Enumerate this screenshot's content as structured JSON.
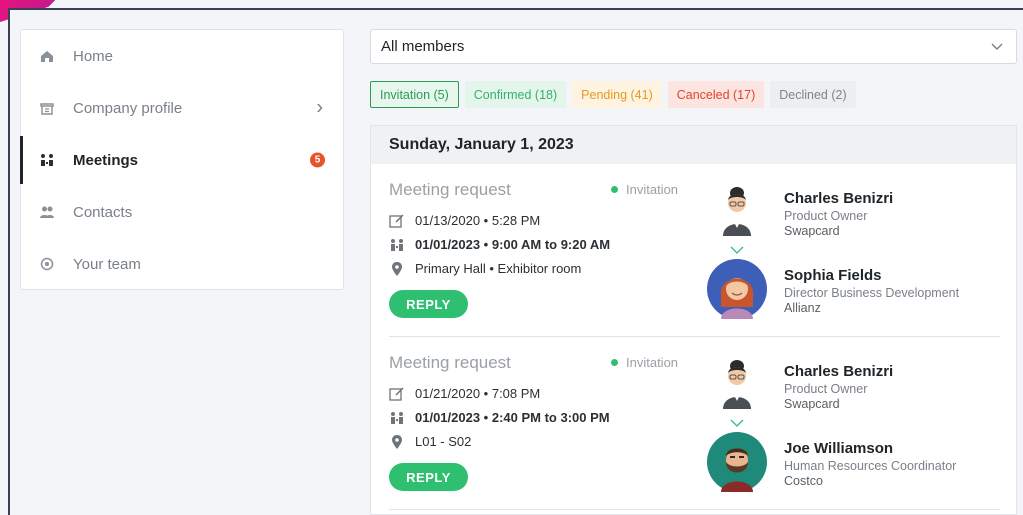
{
  "sidebar": {
    "items": [
      {
        "label": "Home",
        "icon": "home-icon"
      },
      {
        "label": "Company profile",
        "icon": "building-icon"
      },
      {
        "label": "Meetings",
        "icon": "meetings-icon",
        "badge": "5"
      },
      {
        "label": "Contacts",
        "icon": "contacts-icon"
      },
      {
        "label": "Your team",
        "icon": "team-icon"
      }
    ]
  },
  "filter": {
    "selected": "All members"
  },
  "tabs": [
    {
      "label": "Invitation (5)"
    },
    {
      "label": "Confirmed (18)"
    },
    {
      "label": "Pending (41)"
    },
    {
      "label": "Canceled (17)"
    },
    {
      "label": "Declined (2)"
    }
  ],
  "day_header": "Sunday, January 1, 2023",
  "meetings": [
    {
      "title": "Meeting request",
      "status": "Invitation",
      "requested": "01/13/2020 • 5:28 PM",
      "time": "01/01/2023 • 9:00 AM to 9:20 AM",
      "location": "Primary Hall • Exhibitor room",
      "reply_label": "REPLY",
      "host": {
        "name": "Charles Benizri",
        "role": "Product Owner",
        "company": "Swapcard"
      },
      "guest": {
        "name": "Sophia Fields",
        "role": "Director Business Development",
        "company": "Allianz"
      }
    },
    {
      "title": "Meeting request",
      "status": "Invitation",
      "requested": "01/21/2020 • 7:08 PM",
      "time": "01/01/2023 • 2:40 PM to 3:00 PM",
      "location": "L01 - S02",
      "reply_label": "REPLY",
      "host": {
        "name": "Charles Benizri",
        "role": "Product Owner",
        "company": "Swapcard"
      },
      "guest": {
        "name": "Joe Williamson",
        "role": "Human Resources Coordinator",
        "company": "Costco"
      }
    }
  ],
  "colors": {
    "accent_green": "#2fbf71",
    "badge_red": "#e8522a",
    "brand_pink": "#e8137e"
  }
}
